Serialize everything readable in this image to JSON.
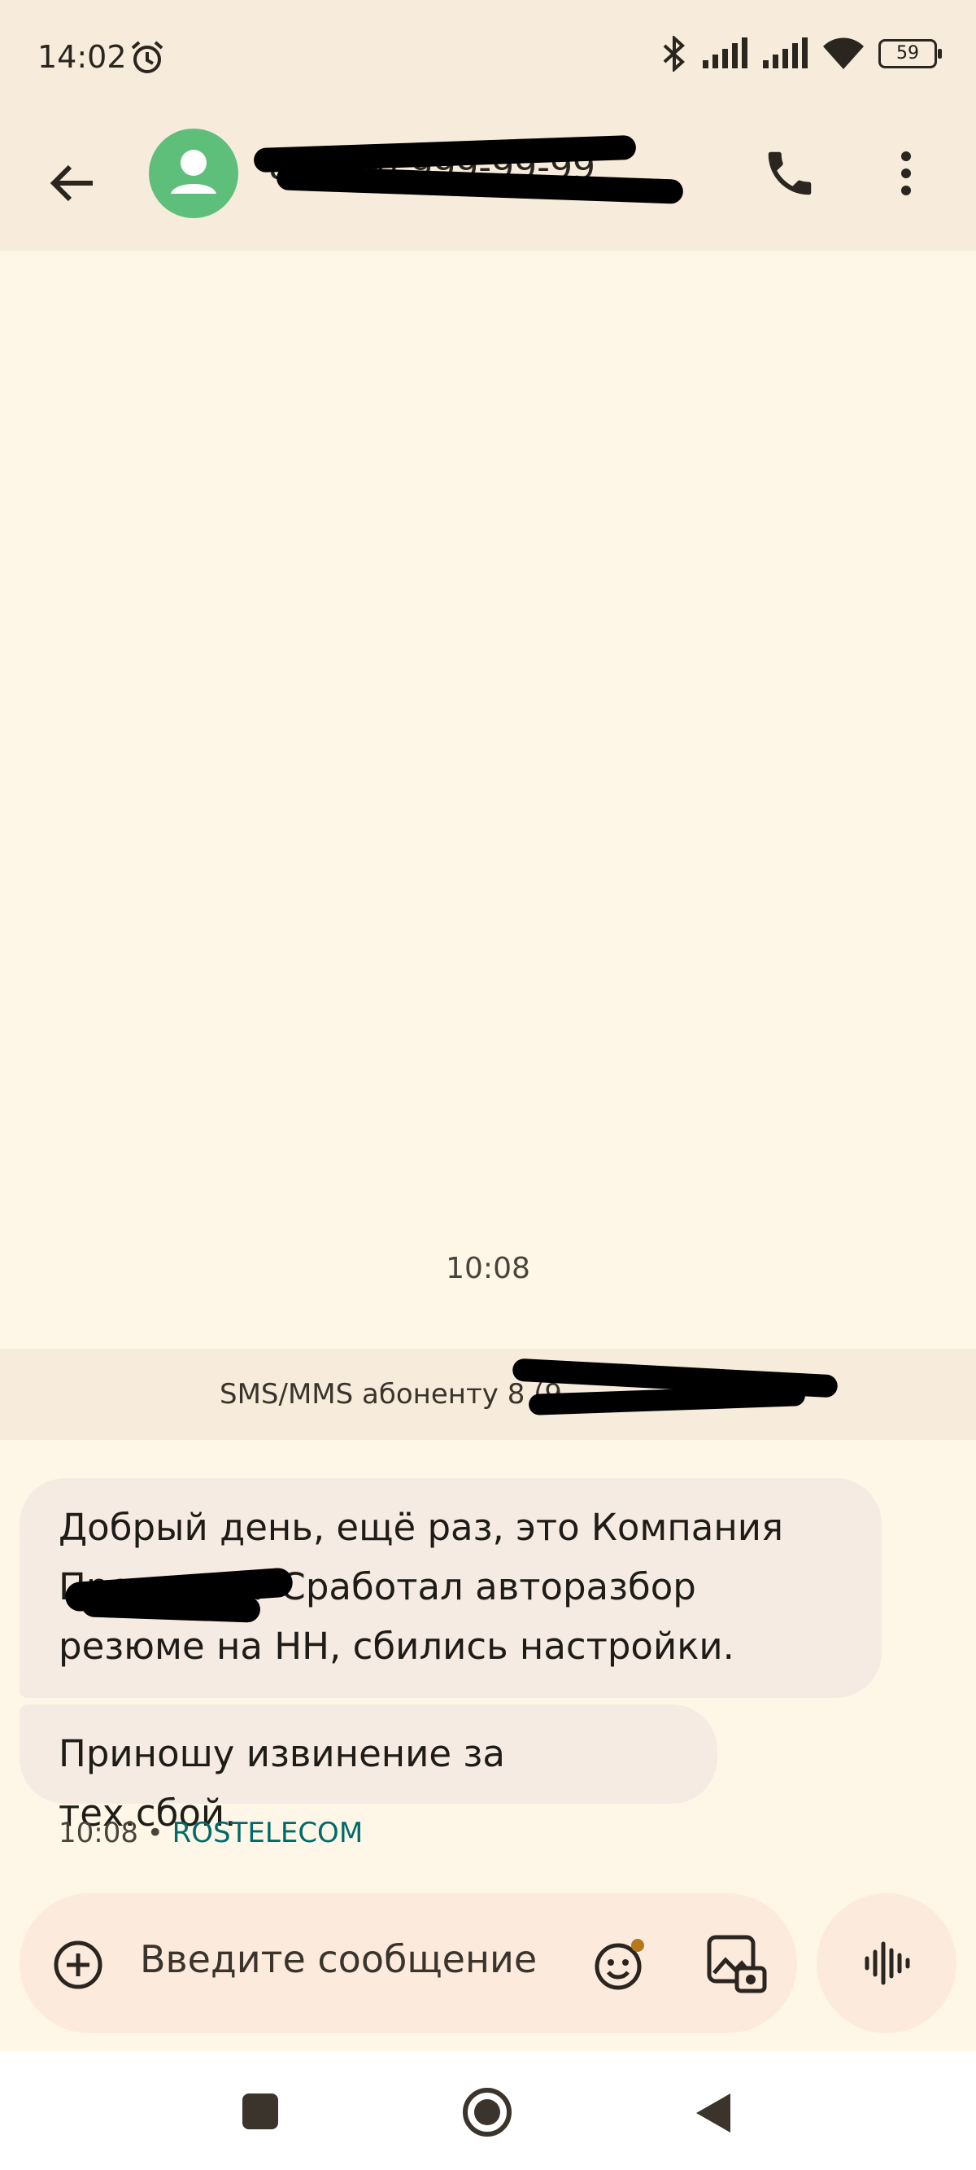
{
  "status_bar": {
    "time": "14:02",
    "battery": "59",
    "icons": [
      "alarm-icon",
      "bluetooth-icon",
      "signal-icon",
      "signal-icon",
      "wifi-icon",
      "battery-icon"
    ]
  },
  "header": {
    "contact_title": "8 (999) 999-99-99",
    "icons": [
      "back-arrow-icon",
      "avatar-icon",
      "phone-icon",
      "more-vert-icon"
    ]
  },
  "conversation": {
    "time_separator": "10:08",
    "info_banner": "SMS/MMS абоненту 8 (9",
    "messages": [
      {
        "text": "Добрый день, ещё раз, это Компания Пролнеорт Сработал авторазбор резюме на НН, сбились настройки."
      },
      {
        "text": "Приношу извинение за тех.сбой."
      }
    ],
    "meta_time": "10:08",
    "meta_separator": "•",
    "meta_carrier": "ROSTELECOM"
  },
  "composer": {
    "placeholder": "Введите сообщение",
    "icons": [
      "add-circle-icon",
      "emoji-icon",
      "gallery-icon",
      "voice-waveform-icon"
    ]
  },
  "navigation": {
    "icons": [
      "recents-icon",
      "home-icon",
      "back-triangle-icon"
    ]
  },
  "colors": {
    "background": "#fef7e8",
    "header": "#f7ecdc",
    "bubble": "#f5ebe2",
    "compose": "#fcebdc",
    "avatar": "#5ebf7a",
    "carrier_link": "#006a6a"
  }
}
